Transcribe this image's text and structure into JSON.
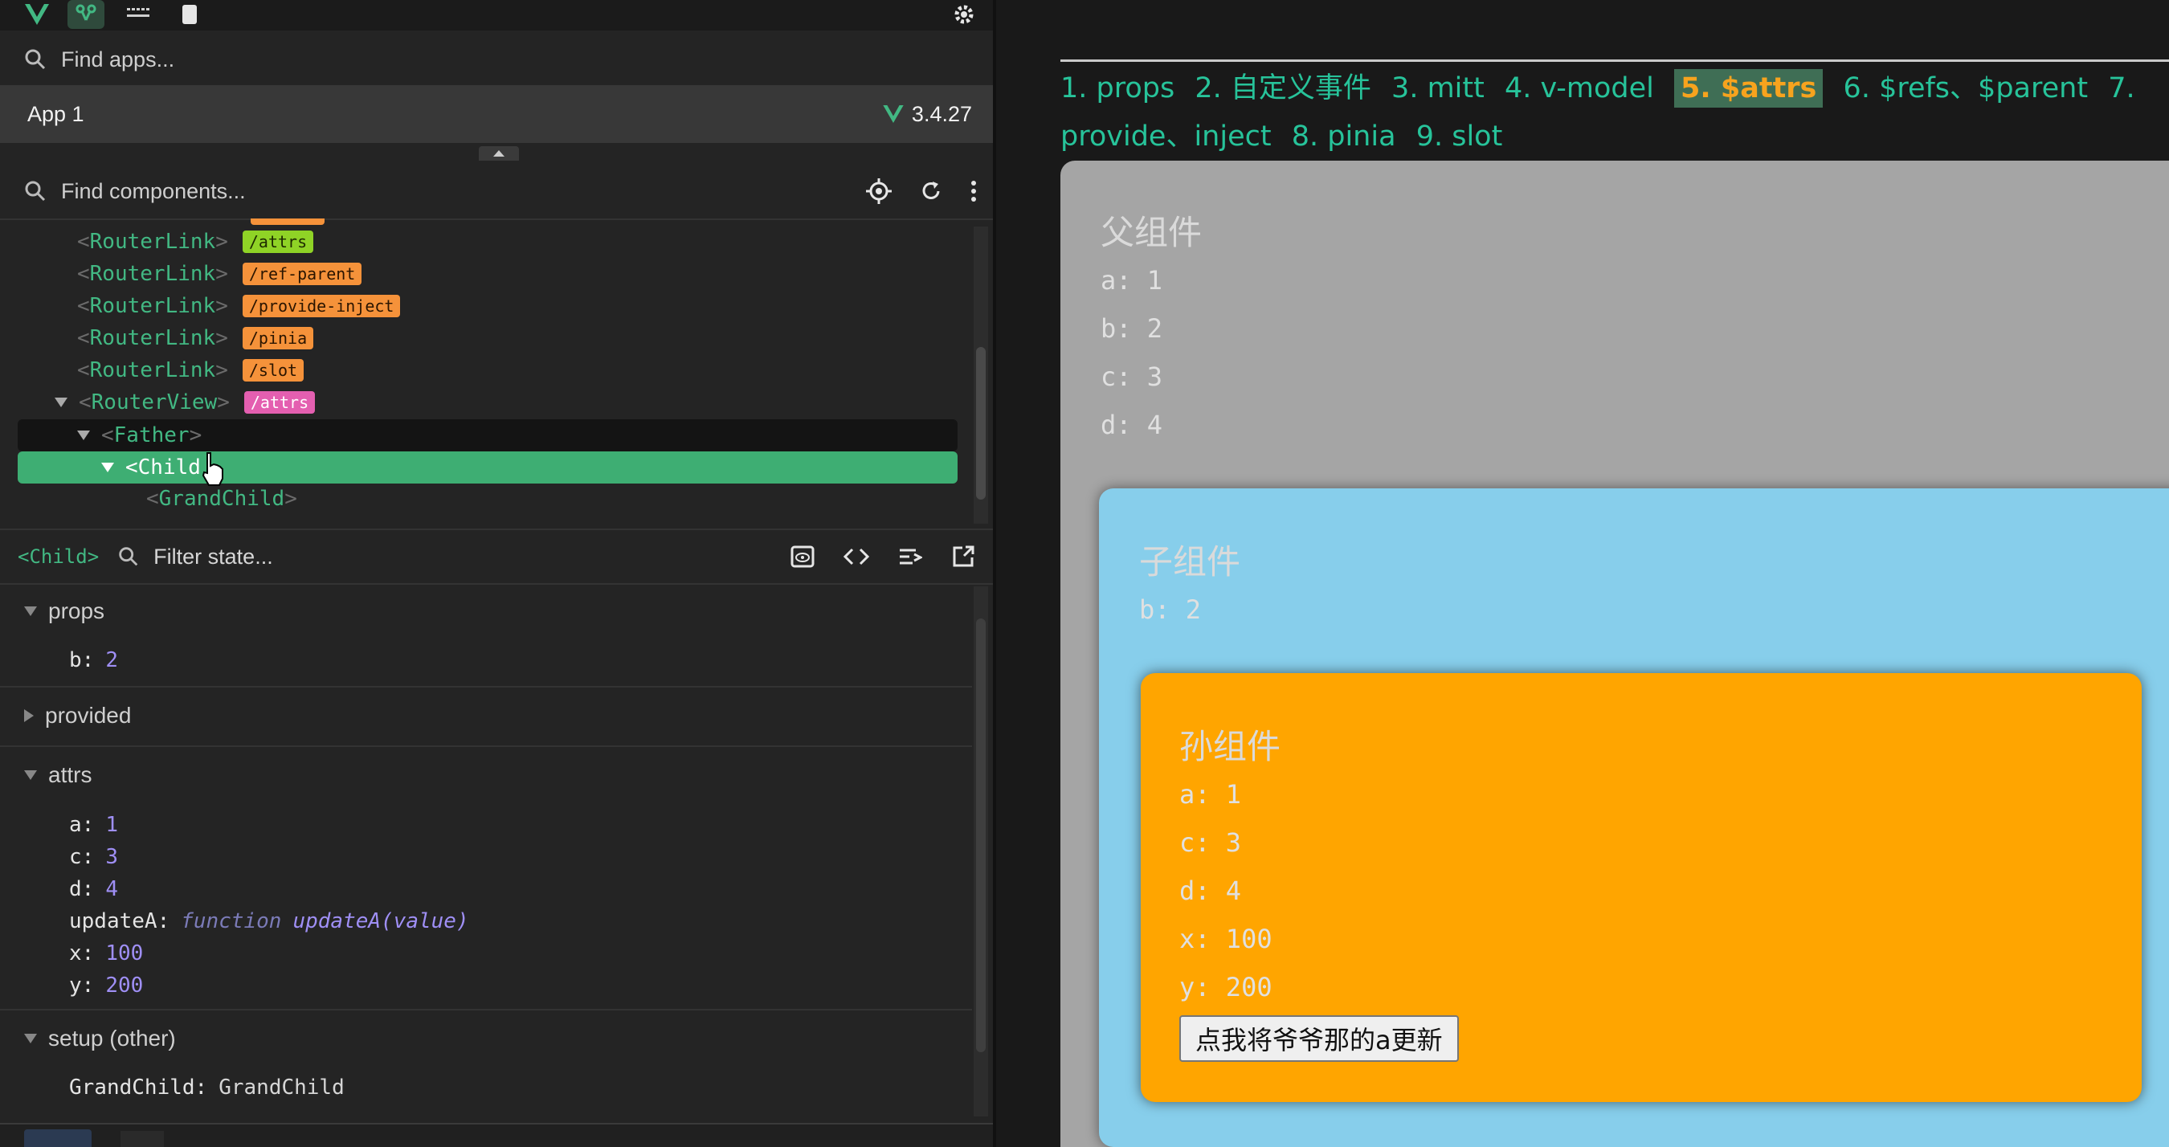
{
  "devtools": {
    "find_apps_placeholder": "Find apps...",
    "app_name": "App 1",
    "vue_version": "3.4.27",
    "find_components_placeholder": "Find components...",
    "tree": {
      "rows": [
        {
          "name": "RouterLink",
          "route": "/attrs",
          "color": "lime"
        },
        {
          "name": "RouterLink",
          "route": "/ref-parent",
          "color": "orange"
        },
        {
          "name": "RouterLink",
          "route": "/provide-inject",
          "color": "orange"
        },
        {
          "name": "RouterLink",
          "route": "/pinia",
          "color": "orange"
        },
        {
          "name": "RouterLink",
          "route": "/slot",
          "color": "orange"
        },
        {
          "name": "RouterView",
          "route": "/attrs",
          "color": "pink"
        }
      ],
      "father": "Father",
      "child": "Child",
      "grandchild": "GrandChild"
    },
    "selected_component": "<Child>",
    "filter_placeholder": "Filter state...",
    "sections": {
      "props": {
        "label": "props",
        "items": [
          {
            "key": "b",
            "value": "2"
          }
        ]
      },
      "provided": {
        "label": "provided"
      },
      "attrs": {
        "label": "attrs",
        "items": [
          {
            "key": "a",
            "value": "1"
          },
          {
            "key": "c",
            "value": "3"
          },
          {
            "key": "d",
            "value": "4"
          },
          {
            "key": "updateA",
            "fn_keyword": "function",
            "fn_sig": "updateA(value)"
          },
          {
            "key": "x",
            "value": "100"
          },
          {
            "key": "y",
            "value": "200"
          }
        ]
      },
      "setup": {
        "label": "setup (other)",
        "items": [
          {
            "key": "GrandChild",
            "value": "GrandChild"
          }
        ]
      }
    }
  },
  "app": {
    "nav": [
      {
        "label": "1. props"
      },
      {
        "label": "2. 自定义事件"
      },
      {
        "label": "3. mitt"
      },
      {
        "label": "4. v-model"
      },
      {
        "label": "5. $attrs",
        "active": true
      },
      {
        "label": "6. $refs、$parent"
      },
      {
        "label": "7. provide、inject"
      },
      {
        "label": "8. pinia"
      },
      {
        "label": "9. slot"
      }
    ],
    "father": {
      "title": "父组件",
      "lines": [
        "a: 1",
        "b: 2",
        "c: 3",
        "d: 4"
      ]
    },
    "child": {
      "title": "子组件",
      "lines": [
        "b: 2"
      ]
    },
    "grandchild": {
      "title": "孙组件",
      "lines": [
        "a: 1",
        "c: 3",
        "d: 4",
        "x: 100",
        "y: 200"
      ]
    },
    "update_button": "点我将爷爷那的a更新"
  },
  "colors": {
    "vue_green": "#42b883",
    "father_bg": "#a5a5a5",
    "child_bg": "#87ceeb",
    "grandchild_bg": "#ffa500",
    "nav_link": "#27c39a",
    "nav_active_text": "#f7a31e",
    "nav_active_bg": "#3f6e55"
  }
}
